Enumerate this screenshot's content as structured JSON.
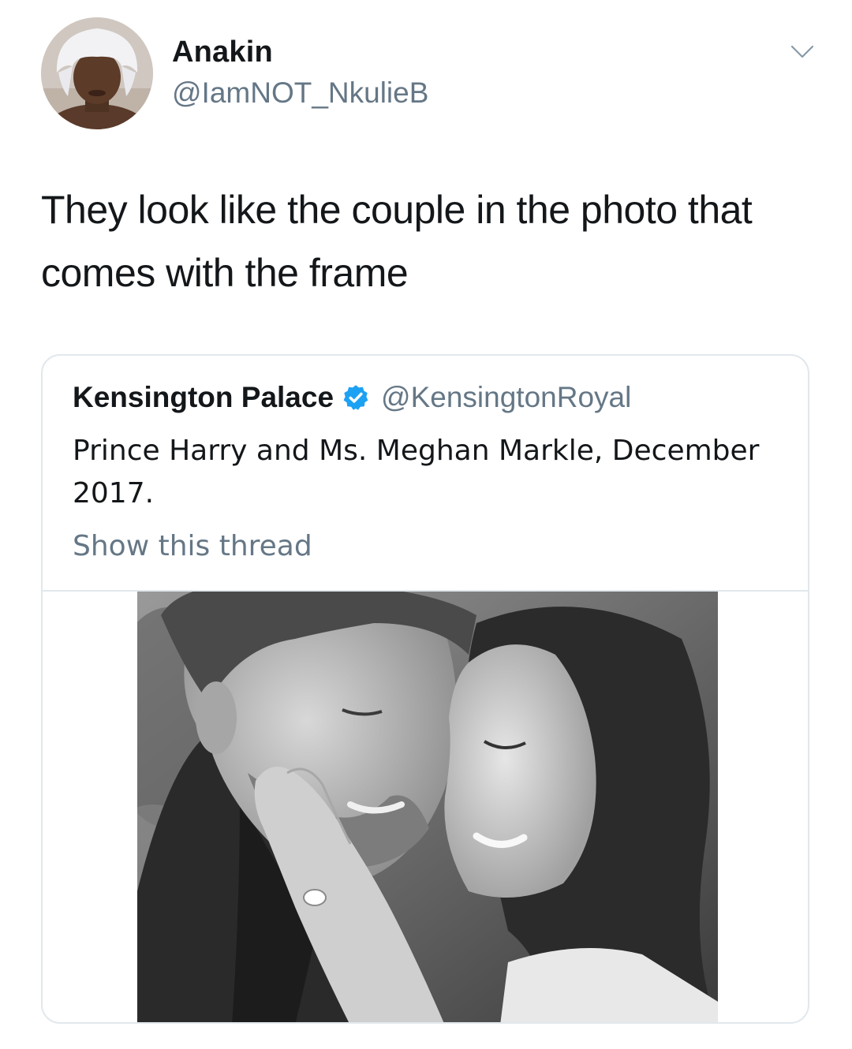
{
  "tweet": {
    "author_name": "Anakin",
    "author_handle": "@IamNOT_NkulieB",
    "text": "They look like the couple in the photo that comes with the frame",
    "menu_icon": "chevron-down-icon",
    "avatar_icon": "avatar"
  },
  "quote": {
    "author_name": "Kensington Palace",
    "verified_icon": "verified-badge-icon",
    "author_handle": "@KensingtonRoyal",
    "text": "Prince Harry and Ms. Meghan Markle, December 2017.",
    "show_thread": "Show this thread"
  },
  "colors": {
    "text_primary": "#14171a",
    "text_secondary": "#657786",
    "border": "#e1e8ed",
    "verified_blue": "#1da1f2"
  }
}
